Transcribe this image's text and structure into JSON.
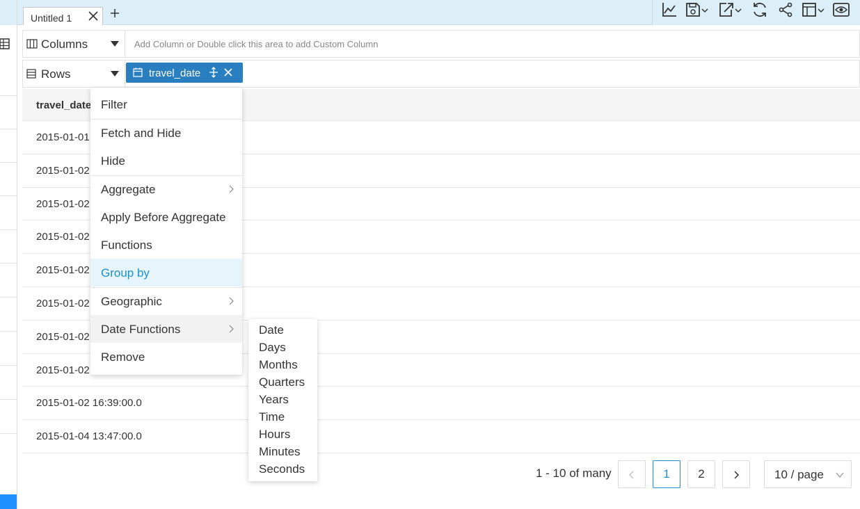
{
  "tabs": [
    {
      "label": "Untitled 1"
    }
  ],
  "columns_shelf": {
    "title": "Columns",
    "placeholder": "Add Column or Double click this area to add Custom Column"
  },
  "rows_shelf": {
    "title": "Rows",
    "pill_label": "travel_date"
  },
  "table": {
    "header": "travel_date",
    "rows": [
      "2015-01-01",
      "2015-01-02",
      "2015-01-02",
      "2015-01-02",
      "2015-01-02",
      "2015-01-02",
      "2015-01-02",
      "2015-01-02",
      "2015-01-02 16:39:00.0",
      "2015-01-04 13:47:00.0"
    ]
  },
  "context_menu": {
    "items": [
      "Filter",
      "Fetch and Hide",
      "Hide",
      "Aggregate",
      "Apply Before Aggregate",
      "Functions",
      "Group by",
      "Geographic",
      "Date Functions",
      "Remove"
    ],
    "active_item": "Group by",
    "hovered_item": "Date Functions"
  },
  "date_functions_submenu": {
    "items": [
      "Date",
      "Days",
      "Months",
      "Quarters",
      "Years",
      "Time",
      "Hours",
      "Minutes",
      "Seconds"
    ]
  },
  "pagination": {
    "summary": "1 - 10 of many",
    "pages": [
      "1",
      "2"
    ],
    "current_page": "1",
    "page_size": "10 / page"
  },
  "colors": {
    "topbar": "#dceef8",
    "pill": "#2a7fc1",
    "accent": "#1e90d2",
    "active_item_bg": "#e6f4fc"
  },
  "icons": [
    "grid-icon",
    "close-icon",
    "plus-icon",
    "line-chart-icon",
    "save-icon",
    "export-icon",
    "refresh-icon",
    "share-icon",
    "layout-icon",
    "preview-icon",
    "columns-icon",
    "rows-icon",
    "caret-down-icon",
    "calendar-icon",
    "move-icon",
    "chevron-right-icon",
    "chevron-left-icon",
    "chevron-down-icon"
  ]
}
